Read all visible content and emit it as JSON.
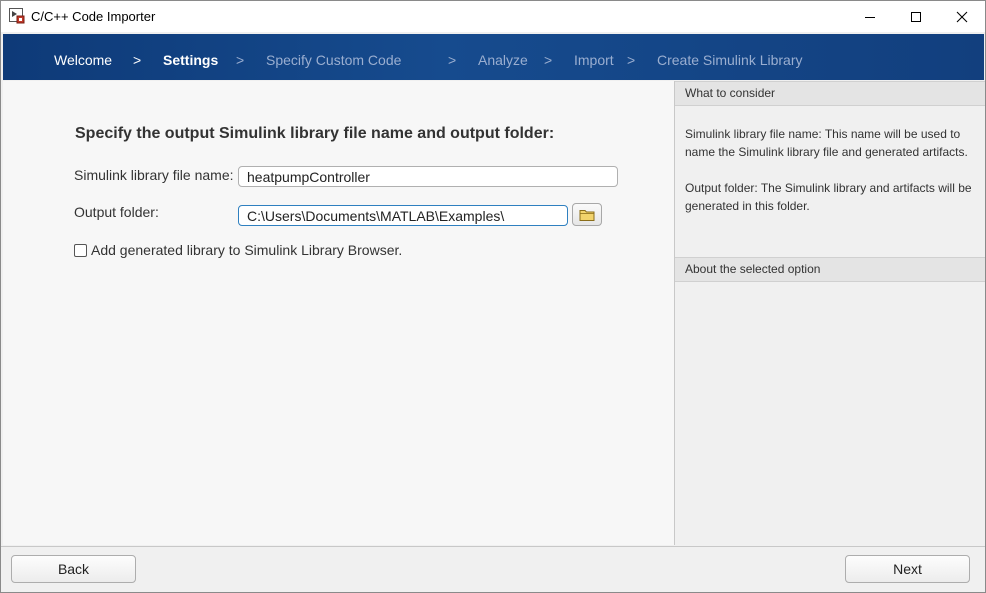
{
  "window": {
    "title": "C/C++ Code Importer"
  },
  "steps": [
    {
      "label": "Welcome"
    },
    {
      "label": "Settings"
    },
    {
      "label": "Specify Custom Code"
    },
    {
      "label": "Analyze"
    },
    {
      "label": "Import"
    },
    {
      "label": "Create Simulink Library"
    }
  ],
  "separator": ">",
  "main": {
    "heading": "Specify the output Simulink library file name and output folder:",
    "library_name": {
      "label": "Simulink library file name:",
      "value": "heatpumpController"
    },
    "output_folder": {
      "label": "Output folder:",
      "value": "C:\\Users\\Documents\\MATLAB\\Examples\\"
    },
    "add_to_browser": {
      "label": "Add generated library to Simulink Library Browser.",
      "checked": false
    }
  },
  "sidebar": {
    "consider_title": "What to consider",
    "consider_text_1": "Simulink library file name: This name will be used to name the Simulink library file and generated artifacts.",
    "consider_text_2": "Output folder: The Simulink library and artifacts will be generated in this folder.",
    "option_title": "About the selected option"
  },
  "footer": {
    "back_label": "Back",
    "next_label": "Next"
  }
}
